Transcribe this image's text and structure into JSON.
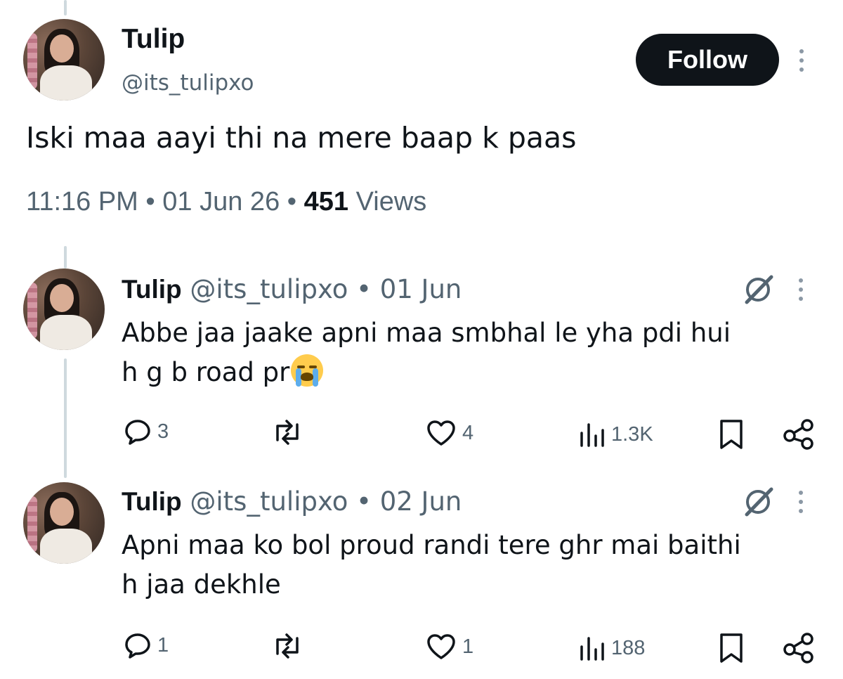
{
  "main_tweet": {
    "name": "Tulip",
    "handle": "@its_tulipxo",
    "follow_label": "Follow",
    "text": "Iski maa aayi thi na mere baap k paas",
    "time": "11:16 PM",
    "separator": "•",
    "date": "01 Jun 26",
    "views_count": "451",
    "views_label": "Views"
  },
  "replies": [
    {
      "name": "Tulip",
      "handle": "@its_tulipxo",
      "separator": "•",
      "date": "01 Jun",
      "line1": "Abbe jaa jaake apni maa smbhal le yha pdi hui",
      "line2": "h g b road pr",
      "emoji": "loudly-crying-face",
      "replies": "3",
      "reposts": "",
      "likes": "4",
      "views": "1.3K"
    },
    {
      "name": "Tulip",
      "handle": "@its_tulipxo",
      "separator": "•",
      "date": "02 Jun",
      "line1": "Apni maa ko bol proud randi tere ghr mai baithi",
      "line2": "h jaa dekhle",
      "replies": "1",
      "reposts": "",
      "likes": "1",
      "views": "188"
    }
  ],
  "icons": {
    "reply": "speech-bubble-icon",
    "repost": "repost-icon",
    "like": "heart-icon",
    "views": "bar-chart-icon",
    "bookmark": "bookmark-icon",
    "share": "share-icon",
    "grok": "grok-icon",
    "more": "kebab-icon"
  },
  "colors": {
    "text": "#0f1419",
    "secondary": "#536471",
    "button_bg": "#0f1419",
    "thread_line": "#cfd9de"
  }
}
